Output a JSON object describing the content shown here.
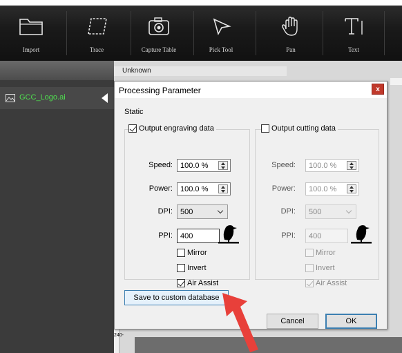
{
  "toolbar": {
    "items": [
      {
        "label": "Import",
        "icon": "folder-icon"
      },
      {
        "label": "Trace",
        "icon": "trace-icon"
      },
      {
        "label": "Capture Table",
        "icon": "camera-icon"
      },
      {
        "label": "Pick Tool",
        "icon": "pointer-icon"
      },
      {
        "label": "Pan",
        "icon": "hand-icon"
      },
      {
        "label": "Text",
        "icon": "text-icon"
      }
    ]
  },
  "sidebar": {
    "file_name": "GCC_Logo.ai"
  },
  "workspace": {
    "layer_name": "Unknown",
    "ruler_label": "240-"
  },
  "dialog": {
    "title": "Processing Parameter",
    "close_label": "x",
    "section_label": "Static",
    "engraving": {
      "title": "Output engraving data",
      "checked": true,
      "speed_label": "Speed:",
      "speed_value": "100.0 %",
      "power_label": "Power:",
      "power_value": "100.0 %",
      "dpi_label": "DPI:",
      "dpi_value": "500",
      "ppi_label": "PPI:",
      "ppi_value": "400",
      "mirror_label": "Mirror",
      "invert_label": "Invert",
      "air_assist_label": "Air Assist",
      "air_assist_checked": true
    },
    "cutting": {
      "title": "Output cutting data",
      "checked": false,
      "speed_label": "Speed:",
      "speed_value": "100.0 %",
      "power_label": "Power:",
      "power_value": "100.0 %",
      "dpi_label": "DPI:",
      "dpi_value": "500",
      "ppi_label": "PPI:",
      "ppi_value": "400",
      "mirror_label": "Mirror",
      "invert_label": "Invert",
      "air_assist_label": "Air Assist",
      "air_assist_checked": true
    },
    "save_button": "Save to custom database",
    "cancel_button": "Cancel",
    "ok_button": "OK"
  },
  "colors": {
    "toolbar_bg": "#1a1a1a",
    "file_text": "#4fe04f",
    "close_btn": "#c0392b",
    "arrow": "#e8403a"
  }
}
